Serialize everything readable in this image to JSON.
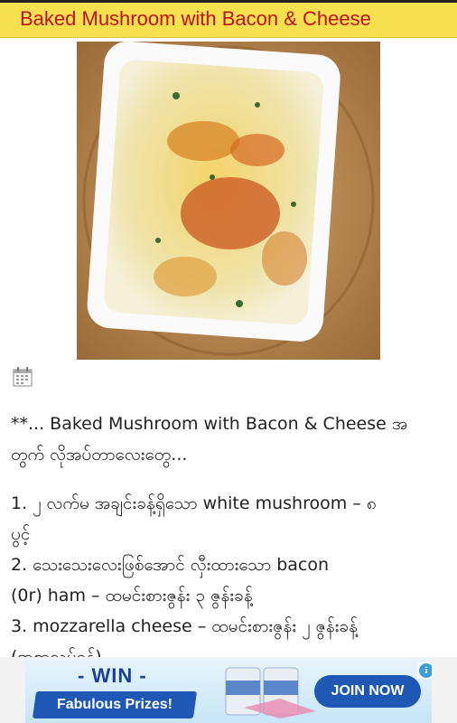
{
  "header": {
    "title": "Baked Mushroom with Bacon & Cheese"
  },
  "photo": {
    "icon": "dish-photo"
  },
  "meta": {
    "calendar_icon": "calendar-icon"
  },
  "article": {
    "intro_line1": "**... Baked Mushroom with Bacon & Cheese အ",
    "intro_line2": "တွက် လိုအပ်တာလေးတွေ...",
    "item1_line1": "1. ၂ လက်မ အချင်းခန့်ရှိသော white mushroom – ၈",
    "item1_line2": "ပွင့်",
    "item2_line1": "2. သေးသေးလေးဖြစ်အောင် လှီးထားသော bacon",
    "item2_line2": "(0r) ham – ထမင်းစားဇွန်း ၃ ဇွန်းခန့်",
    "item3_line1": "3. mozzarella cheese – ထမင်းစားဇွန်း ၂ ဇွန်းခန့်",
    "item3_line2": "(အစာသွပ်ရန်)"
  },
  "ad": {
    "headline": "- WIN -",
    "sub": "Fabulous Prizes!",
    "cta": "JOIN NOW",
    "info_icon_text": "i",
    "close_icon_text": "✕",
    "colors": {
      "primary": "#1f57b4",
      "accent": "#3a9fd8"
    }
  },
  "colors": {
    "header_bg": "#f5e04e",
    "header_text": "#c0121b"
  }
}
